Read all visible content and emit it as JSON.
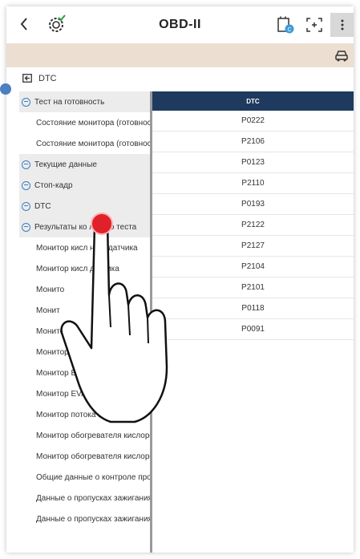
{
  "header": {
    "title": "OBD-II",
    "back_icon": "chevron-left-icon",
    "logo_icon": "gear-check-icon"
  },
  "breadcrumb": {
    "label": "DTC"
  },
  "tree": {
    "items": [
      {
        "label": "Тест на готовность",
        "type": "section"
      },
      {
        "label": "Состояние монитора (готовност",
        "type": "child"
      },
      {
        "label": "Состояние монитора (готовност",
        "type": "child"
      },
      {
        "label": "Текущие данные",
        "type": "section"
      },
      {
        "label": "Стоп-кадр",
        "type": "section"
      },
      {
        "label": "DTC",
        "type": "section"
      },
      {
        "label": "Результаты ко   льного теста",
        "type": "section"
      },
      {
        "label": "Монитор кисл   ного датчика",
        "type": "child"
      },
      {
        "label": "Монитор кисл       датчика",
        "type": "child"
      },
      {
        "label": "Монито",
        "type": "child"
      },
      {
        "label": "Монит",
        "type": "child"
      },
      {
        "label": "Монито",
        "type": "child"
      },
      {
        "label": "Монитор E",
        "type": "child"
      },
      {
        "label": "Монитор EVAF",
        "type": "child"
      },
      {
        "label": "Монитор EVAP - (",
        "type": "child"
      },
      {
        "label": "Монитор потока продувки",
        "type": "child"
      },
      {
        "label": "Монитор обогревателя кислоро",
        "type": "child"
      },
      {
        "label": "Монитор обогревателя кислород",
        "type": "child"
      },
      {
        "label": "Общие данные о контроле пропу",
        "type": "child"
      },
      {
        "label": "Данные о пропусках зажигания д",
        "type": "child"
      },
      {
        "label": "Данные о пропусках зажигания д",
        "type": "child"
      }
    ]
  },
  "dtc_table": {
    "header": "DTC",
    "rows": [
      "P0222",
      "P2106",
      "P0123",
      "P2110",
      "P0193",
      "P2122",
      "P2127",
      "P2104",
      "P2101",
      "P0118",
      "P0091"
    ]
  },
  "colors": {
    "info_bar": "#ecdfd2",
    "table_header": "#1e3a5f",
    "accent_blue": "#3a7fc4",
    "touch_dot": "#e0202a"
  }
}
